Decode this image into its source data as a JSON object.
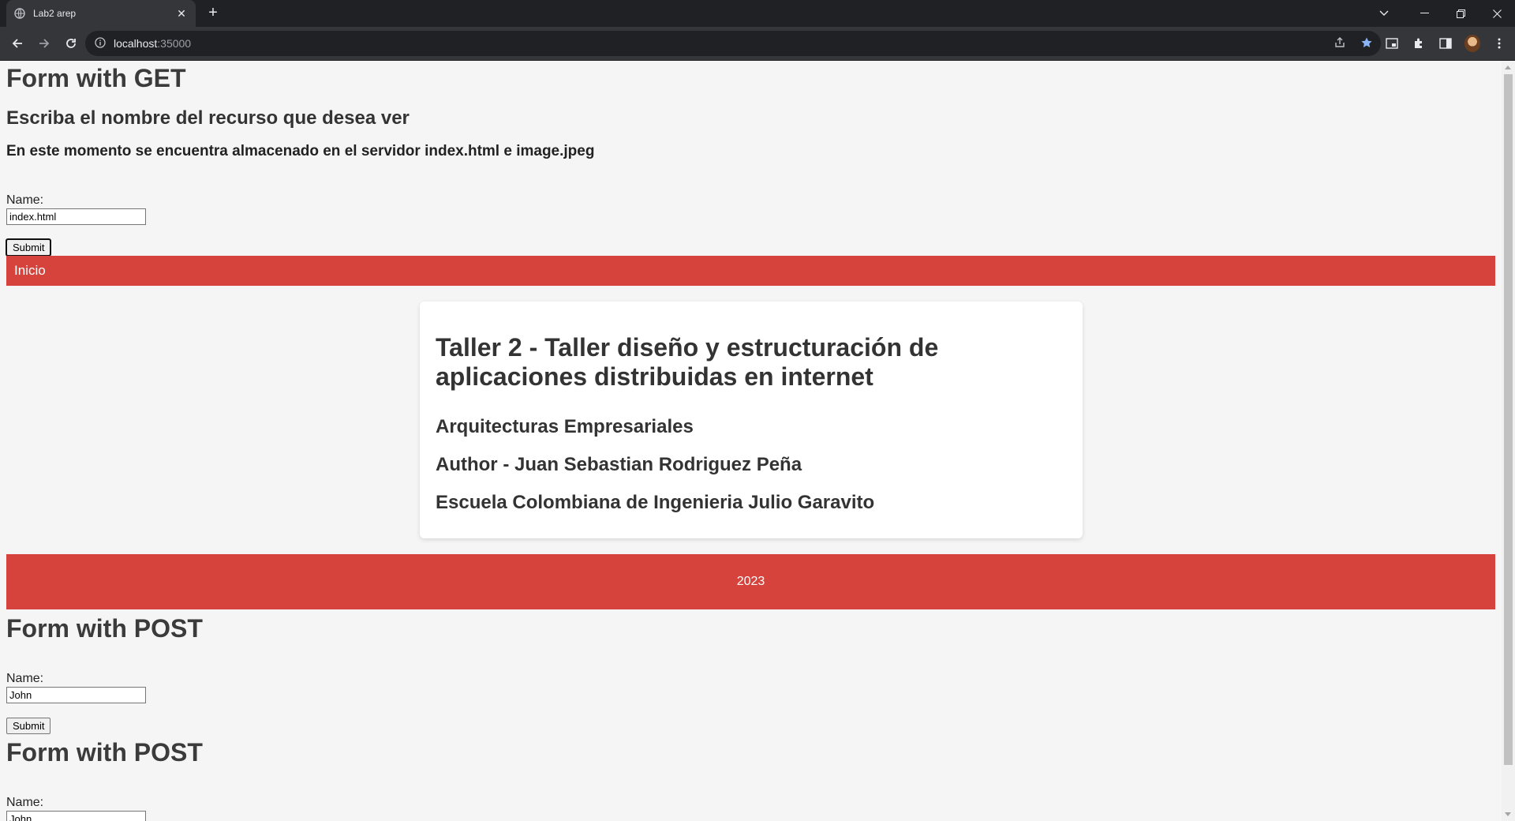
{
  "browser": {
    "tab_title": "Lab2 arep",
    "url_host": "localhost",
    "url_port": ":35000"
  },
  "get_form": {
    "heading": "Form with GET",
    "subheading": "Escriba el nombre del recurso que desea ver",
    "info": "En este momento se encuentra almacenado en el servidor index.html e image.jpeg",
    "name_label": "Name:",
    "name_value": "index.html",
    "submit_label": "Submit"
  },
  "navbar": {
    "link": "Inicio"
  },
  "card": {
    "title": "Taller 2 - Taller diseño y estructuración de aplicaciones distribuidas en internet",
    "course": "Arquitecturas Empresariales",
    "author": "Author - Juan Sebastian Rodriguez Peña",
    "school": "Escuela Colombiana de Ingenieria Julio Garavito"
  },
  "footer": {
    "year": "2023"
  },
  "post_form_1": {
    "heading": "Form with POST",
    "name_label": "Name:",
    "name_value": "John",
    "submit_label": "Submit"
  },
  "post_form_2": {
    "heading": "Form with POST",
    "name_label": "Name:",
    "name_value": "John"
  },
  "colors": {
    "accent": "#d5433c",
    "background": "#f5f5f5",
    "chrome": "#35363a"
  }
}
